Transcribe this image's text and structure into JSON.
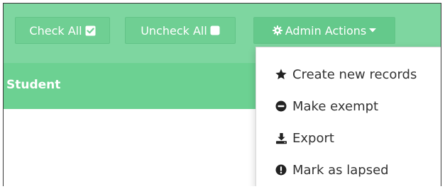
{
  "toolbar": {
    "check_all_label": "Check All",
    "uncheck_all_label": "Uncheck All",
    "admin_actions_label": "Admin Actions"
  },
  "table": {
    "student_header": "Student"
  },
  "admin_menu": {
    "items": [
      {
        "label": "Create new records",
        "icon": "star-icon"
      },
      {
        "label": "Make exempt",
        "icon": "minus-circle-icon"
      },
      {
        "label": "Export",
        "icon": "download-icon"
      },
      {
        "label": "Mark as lapsed",
        "icon": "exclamation-circle-icon"
      }
    ]
  },
  "colors": {
    "toolbar_bg": "#7ed6a0",
    "button_bg": "#6fcf93",
    "header_bg": "#6cd192",
    "menu_text": "#333333"
  }
}
